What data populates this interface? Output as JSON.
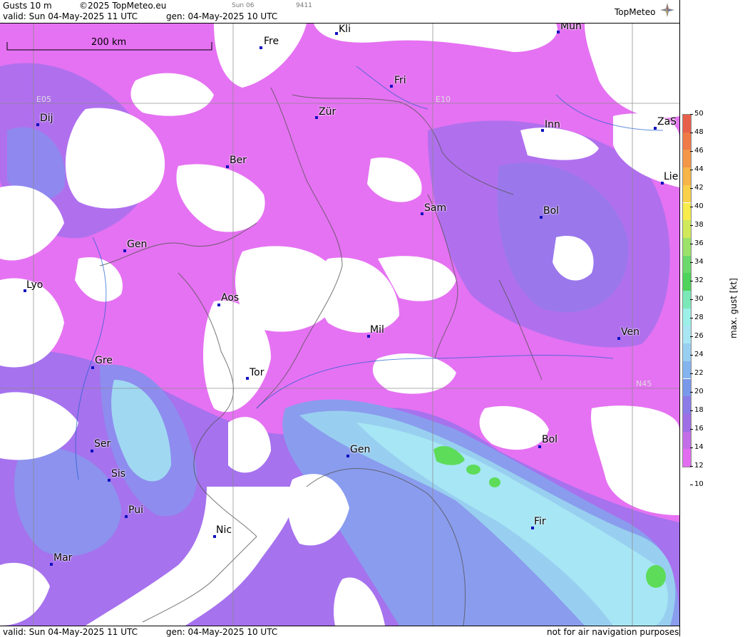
{
  "header": {
    "title": "Gusts 10 m",
    "copyright": "©2025 TopMeteo.eu",
    "day": "Sun 06",
    "code": "9411",
    "valid": "valid:  Sun  04-May-2025  11 UTC",
    "generated": "gen: 04-May-2025 10 UTC",
    "brand": "TopMeteo"
  },
  "footer": {
    "valid": "valid:  Sun  04-May-2025  11 UTC",
    "generated": "gen: 04-May-2025 10 UTC",
    "disclaimer": "not for air navigation purposes"
  },
  "map": {
    "scale_label": "200 km",
    "grid_labels": [
      "E05",
      "E10",
      "N45"
    ],
    "cities": [
      {
        "name": "Kli"
      },
      {
        "name": "Mün"
      },
      {
        "name": "Fre"
      },
      {
        "name": "Fri"
      },
      {
        "name": "Dij"
      },
      {
        "name": "Zür"
      },
      {
        "name": "Inn"
      },
      {
        "name": "ZaS"
      },
      {
        "name": "Ber"
      },
      {
        "name": "Lie"
      },
      {
        "name": "Sam"
      },
      {
        "name": "Bol"
      },
      {
        "name": "Gen"
      },
      {
        "name": "Lyo"
      },
      {
        "name": "Aos"
      },
      {
        "name": "Mil"
      },
      {
        "name": "Ven"
      },
      {
        "name": "Gre"
      },
      {
        "name": "Tor"
      },
      {
        "name": "Ser"
      },
      {
        "name": "Gen"
      },
      {
        "name": "Bol"
      },
      {
        "name": "Sis"
      },
      {
        "name": "Pui"
      },
      {
        "name": "Nic"
      },
      {
        "name": "Fir"
      },
      {
        "name": "Mar"
      }
    ]
  },
  "legend": {
    "unit_label": "max. gust [kt]",
    "ticks": [
      "50",
      "48",
      "46",
      "44",
      "42",
      "40",
      "38",
      "36",
      "34",
      "32",
      "30",
      "28",
      "26",
      "24",
      "22",
      "20",
      "18",
      "16",
      "14",
      "12",
      "10"
    ],
    "colors": [
      "#e8604a",
      "#ef7a48",
      "#f39648",
      "#f7b448",
      "#f9d048",
      "#f7ec4a",
      "#cfe95a",
      "#9ce26a",
      "#6cd96c",
      "#4fd35a",
      "#7ae8b8",
      "#9cf0e8",
      "#a8e6f4",
      "#98cff0",
      "#84b4ee",
      "#7a98ea",
      "#8a7ce8",
      "#9e6ee6",
      "#c26ee8",
      "#e26cf0"
    ]
  },
  "colors": {
    "field_low": "#e572f2",
    "field_mid": "#9b74ec",
    "field_blue": "#7e9bee",
    "field_cyan": "#a7e6f4",
    "field_green": "#5ddc5a"
  }
}
